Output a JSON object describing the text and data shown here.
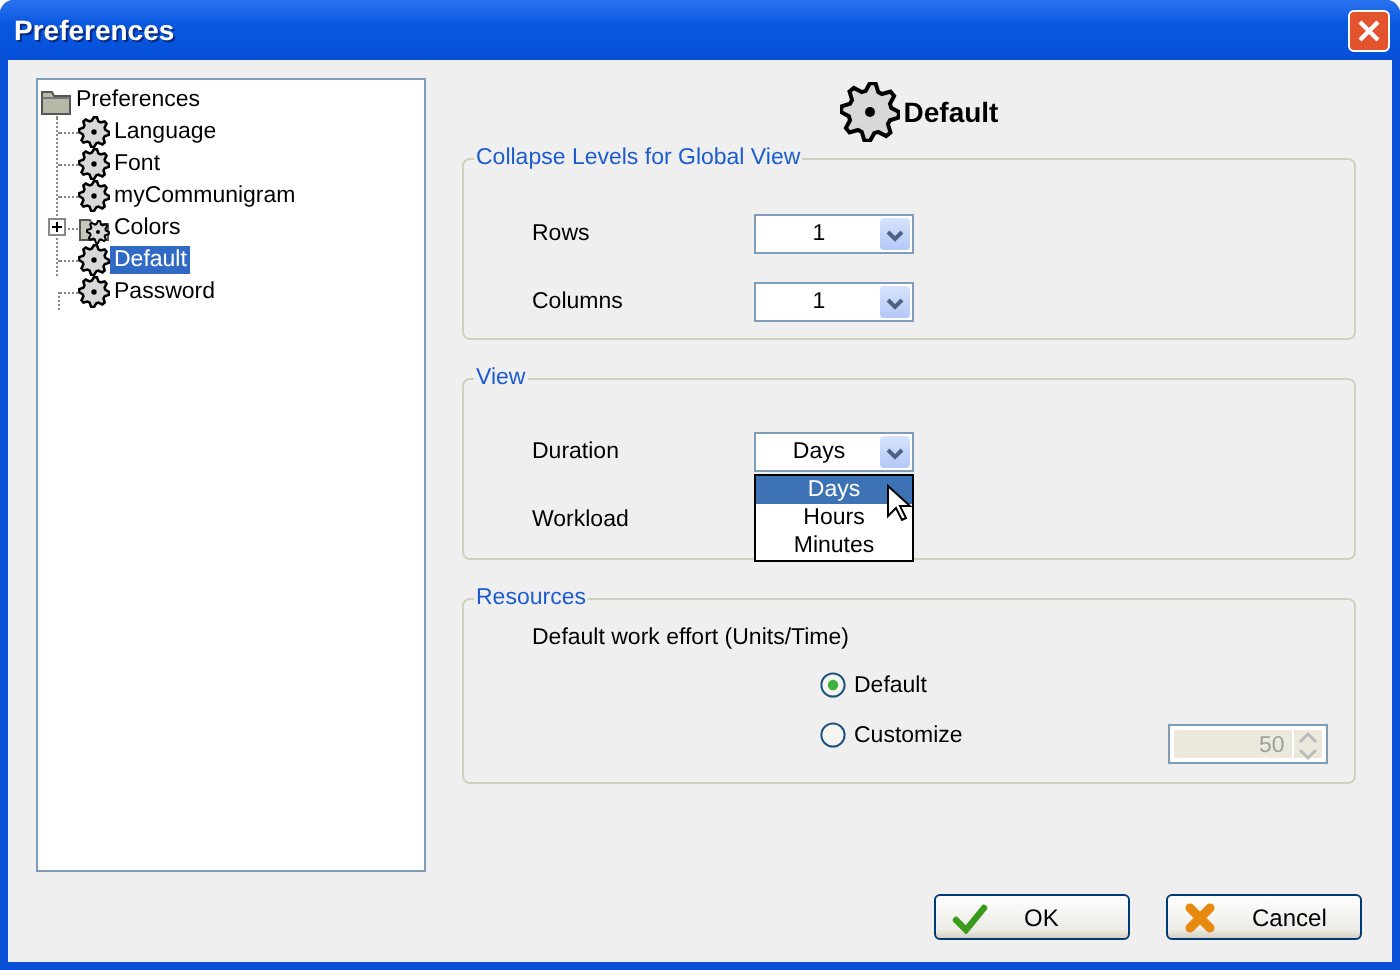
{
  "window": {
    "title": "Preferences"
  },
  "tree": [
    {
      "label": "Preferences",
      "kind": "root",
      "selected": false,
      "children": [
        {
          "label": "Language",
          "kind": "page",
          "selected": false
        },
        {
          "label": "Font",
          "kind": "page",
          "selected": false
        },
        {
          "label": "myCommunigram",
          "kind": "page",
          "selected": false
        },
        {
          "label": "Colors",
          "kind": "group",
          "expanded": false,
          "selected": false
        },
        {
          "label": "Default",
          "kind": "page",
          "selected": true
        },
        {
          "label": "Password",
          "kind": "page",
          "selected": false
        }
      ]
    }
  ],
  "page": {
    "title": "Default"
  },
  "groups": [
    {
      "title": "Collapse Levels for Global View",
      "kind": "selects",
      "rows": [
        {
          "label": "Rows",
          "value": "1"
        },
        {
          "label": "Columns",
          "value": "1"
        }
      ]
    },
    {
      "title": "View",
      "kind": "selects",
      "rows": [
        {
          "label": "Duration",
          "value": "Days",
          "options": [
            {
              "label": "Days",
              "selected": true
            },
            {
              "label": "Hours",
              "selected": false
            },
            {
              "label": "Minutes",
              "selected": false
            }
          ]
        },
        {
          "label": "Workload"
        }
      ]
    },
    {
      "title": "Resources",
      "kind": "radios",
      "caption": "Default work effort (Units/Time)",
      "options": [
        {
          "label": "Default",
          "selected": true
        },
        {
          "label": "Customize",
          "selected": false
        }
      ],
      "spinner": {
        "value": "50",
        "disabled": true
      }
    }
  ],
  "buttons": [
    {
      "label": "OK",
      "kind": "ok"
    },
    {
      "label": "Cancel",
      "kind": "cancel"
    }
  ]
}
